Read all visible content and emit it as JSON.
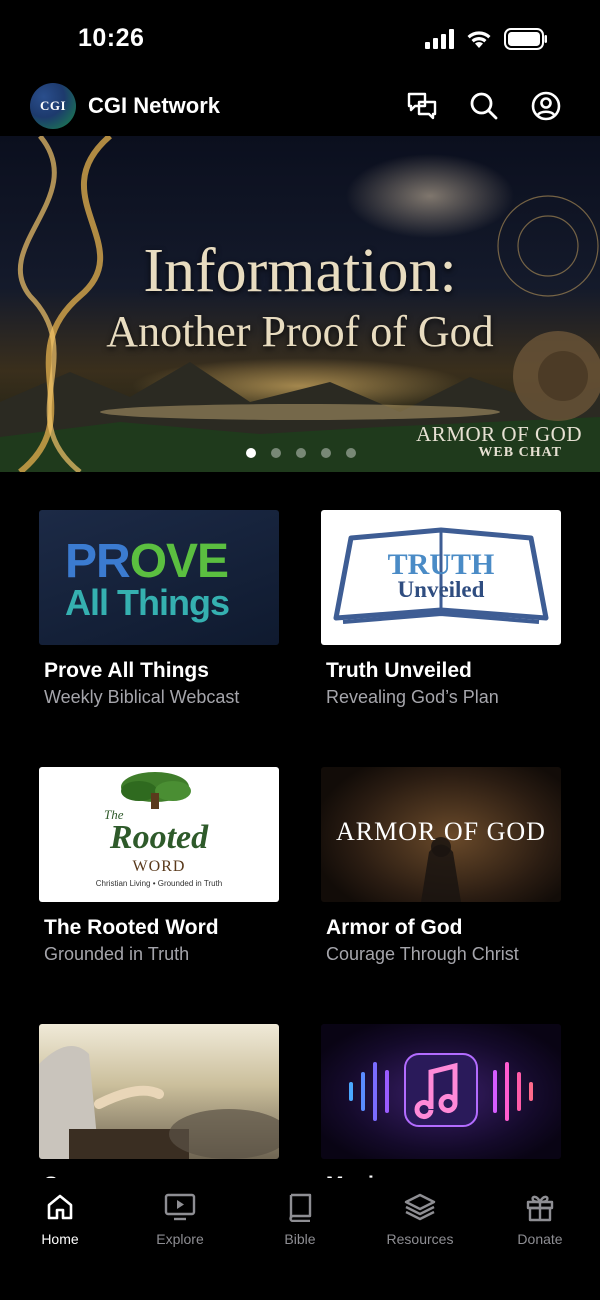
{
  "status_bar": {
    "time": "10:26"
  },
  "header": {
    "logo_text": "CGI",
    "title": "CGI Network"
  },
  "hero": {
    "title_line1": "Information:",
    "title_line2": "Another Proof of God",
    "brand_line1": "ARMOR OF GOD",
    "brand_line2": "WEB CHAT",
    "slide_count": 5,
    "active_slide": 1
  },
  "programs": [
    {
      "title": "Prove All Things",
      "subtitle": "Weekly Biblical Webcast",
      "thumb_line1": "PROVE",
      "thumb_line2": "All Things"
    },
    {
      "title": "Truth Unveiled",
      "subtitle": "Revealing God’s Plan",
      "thumb_line1": "TRUTH",
      "thumb_line2": "Unveiled"
    },
    {
      "title": "The Rooted Word",
      "subtitle": "Grounded in Truth",
      "thumb_line1": "The",
      "thumb_line2": "Rooted",
      "thumb_line3": "WORD",
      "thumb_tagline": "Christian Living • Grounded in Truth"
    },
    {
      "title": "Armor of God",
      "subtitle": "Courage Through Christ",
      "thumb_line1": "ARMOR OF GOD"
    },
    {
      "title": "Sermons",
      "subtitle": ""
    },
    {
      "title": "Music",
      "subtitle": ""
    }
  ],
  "nav": [
    {
      "label": "Home",
      "icon": "home-icon",
      "active": true
    },
    {
      "label": "Explore",
      "icon": "tv-icon",
      "active": false
    },
    {
      "label": "Bible",
      "icon": "book-icon",
      "active": false
    },
    {
      "label": "Resources",
      "icon": "layers-icon",
      "active": false
    },
    {
      "label": "Donate",
      "icon": "gift-icon",
      "active": false
    }
  ],
  "colors": {
    "background": "#000000",
    "subtitle": "#a5a5ab",
    "nav_inactive": "#8e8e93"
  }
}
